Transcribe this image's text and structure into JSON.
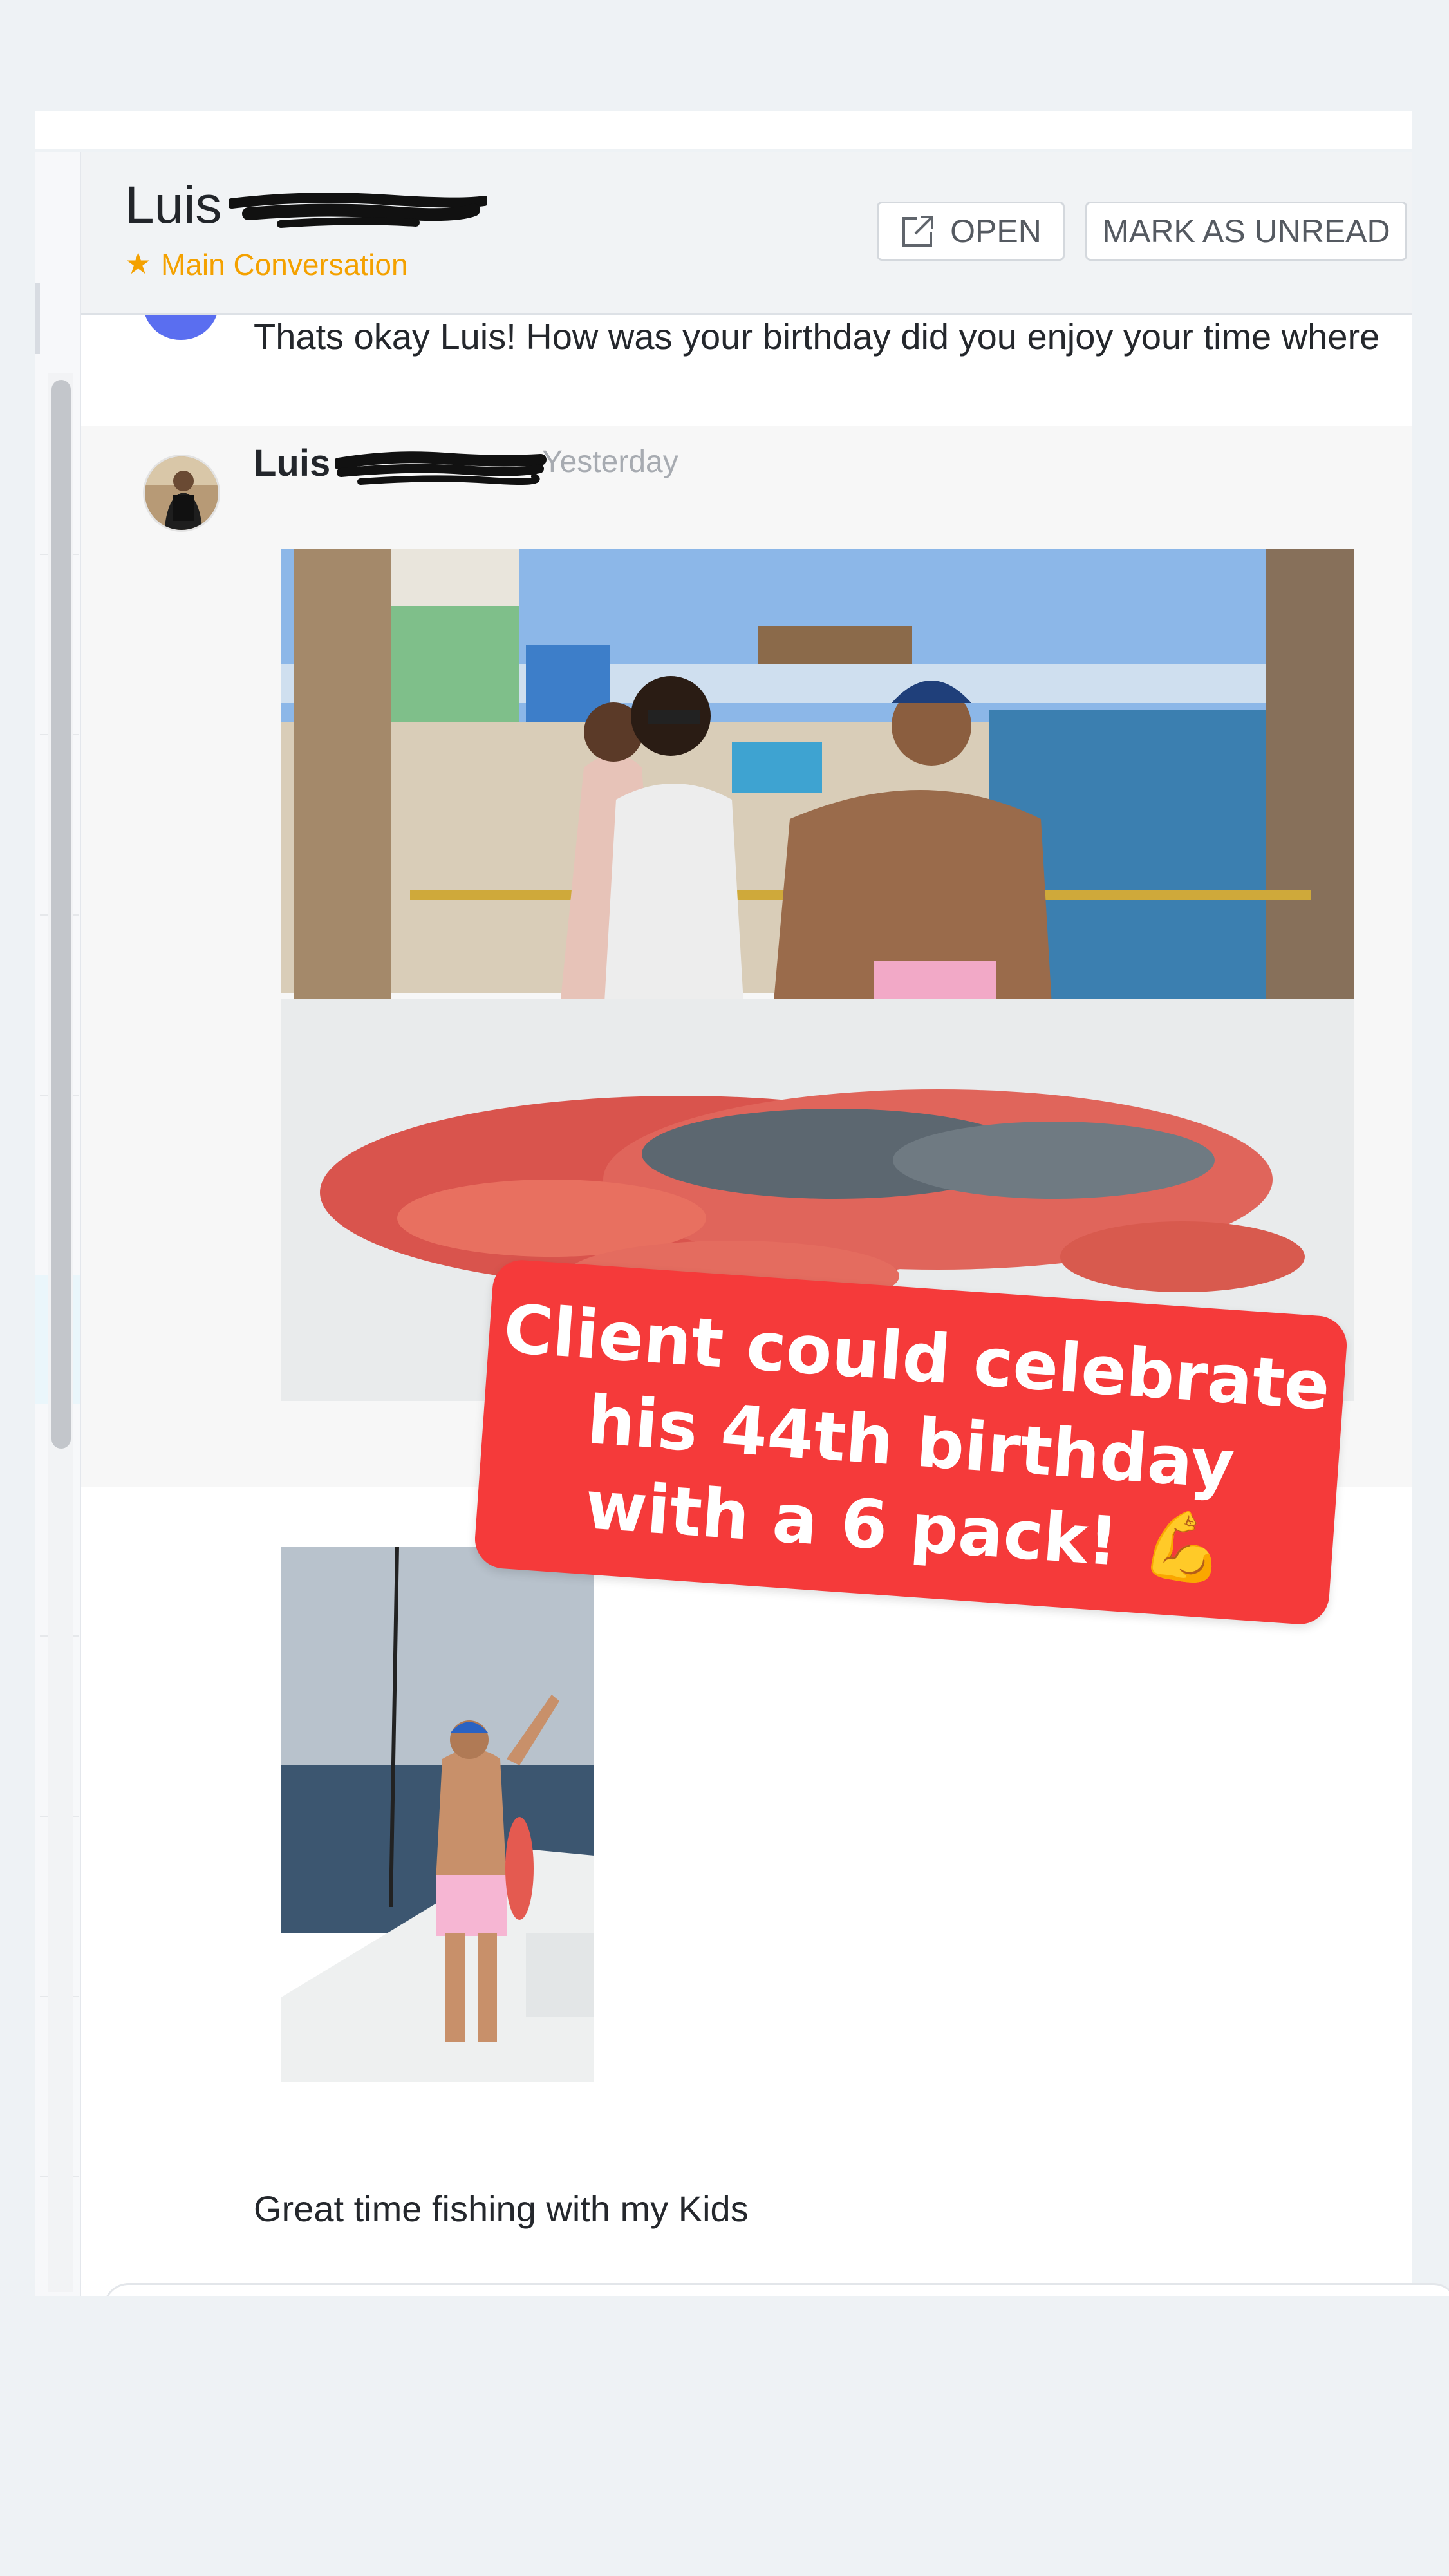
{
  "header": {
    "contact_name": "Luis",
    "conversation_label": "Main Conversation",
    "star_icon": "★",
    "open_label": "OPEN",
    "mark_unread_label": "MARK AS UNREAD"
  },
  "messages": {
    "previous": "Thats okay Luis! How was your birthday did you enjoy your time where",
    "current": {
      "sender": "Luis",
      "timestamp": "Yesterday",
      "caption": "Great time fishing with my Kids"
    }
  },
  "sticker": {
    "line1": "Client could celebrate",
    "line2": "his 44th birthday",
    "line3": "with a 6 pack! 💪"
  },
  "colors": {
    "accent_star": "#f4a100",
    "sticker_bg": "#f53a3a",
    "avatar_blue": "#5a6ef0"
  }
}
